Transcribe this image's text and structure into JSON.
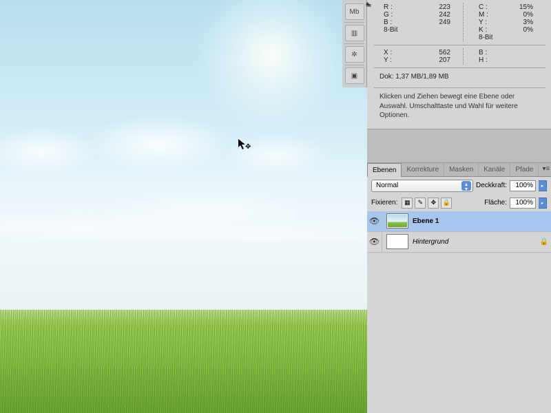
{
  "info": {
    "rgb": {
      "r_label": "R :",
      "r": "223",
      "g_label": "G :",
      "g": "242",
      "b_label": "B :",
      "b": "249",
      "depth": "8-Bit"
    },
    "cmyk": {
      "c_label": "C :",
      "c": "15%",
      "m_label": "M :",
      "m": "0%",
      "y_label": "Y :",
      "y": "3%",
      "k_label": "K :",
      "k": "0%",
      "depth": "8-Bit"
    },
    "xy": {
      "x_label": "X :",
      "x": "562",
      "y_label": "Y :",
      "y": "207"
    },
    "wh": {
      "b_label": "B :",
      "b": "",
      "h_label": "H :",
      "h": ""
    },
    "dok": "Dok: 1,37 MB/1,89 MB",
    "hint": "Klicken und Ziehen bewegt eine Ebene oder Auswahl. Umschalttaste und Wahl für weitere Optionen."
  },
  "toolstrip": {
    "mb": "Mb"
  },
  "panel": {
    "tabs": {
      "ebenen": "Ebenen",
      "korrekture": "Korrekture",
      "masken": "Masken",
      "kanale": "Kanäle",
      "pfade": "Pfade"
    },
    "blend": {
      "mode": "Normal",
      "opacity_label": "Deckkraft:",
      "opacity": "100%"
    },
    "lock": {
      "label": "Fixieren:",
      "fill_label": "Fläche:",
      "fill": "100%"
    },
    "layers": [
      {
        "name": "Ebene 1",
        "locked": false
      },
      {
        "name": "Hintergrund",
        "locked": true
      }
    ]
  }
}
